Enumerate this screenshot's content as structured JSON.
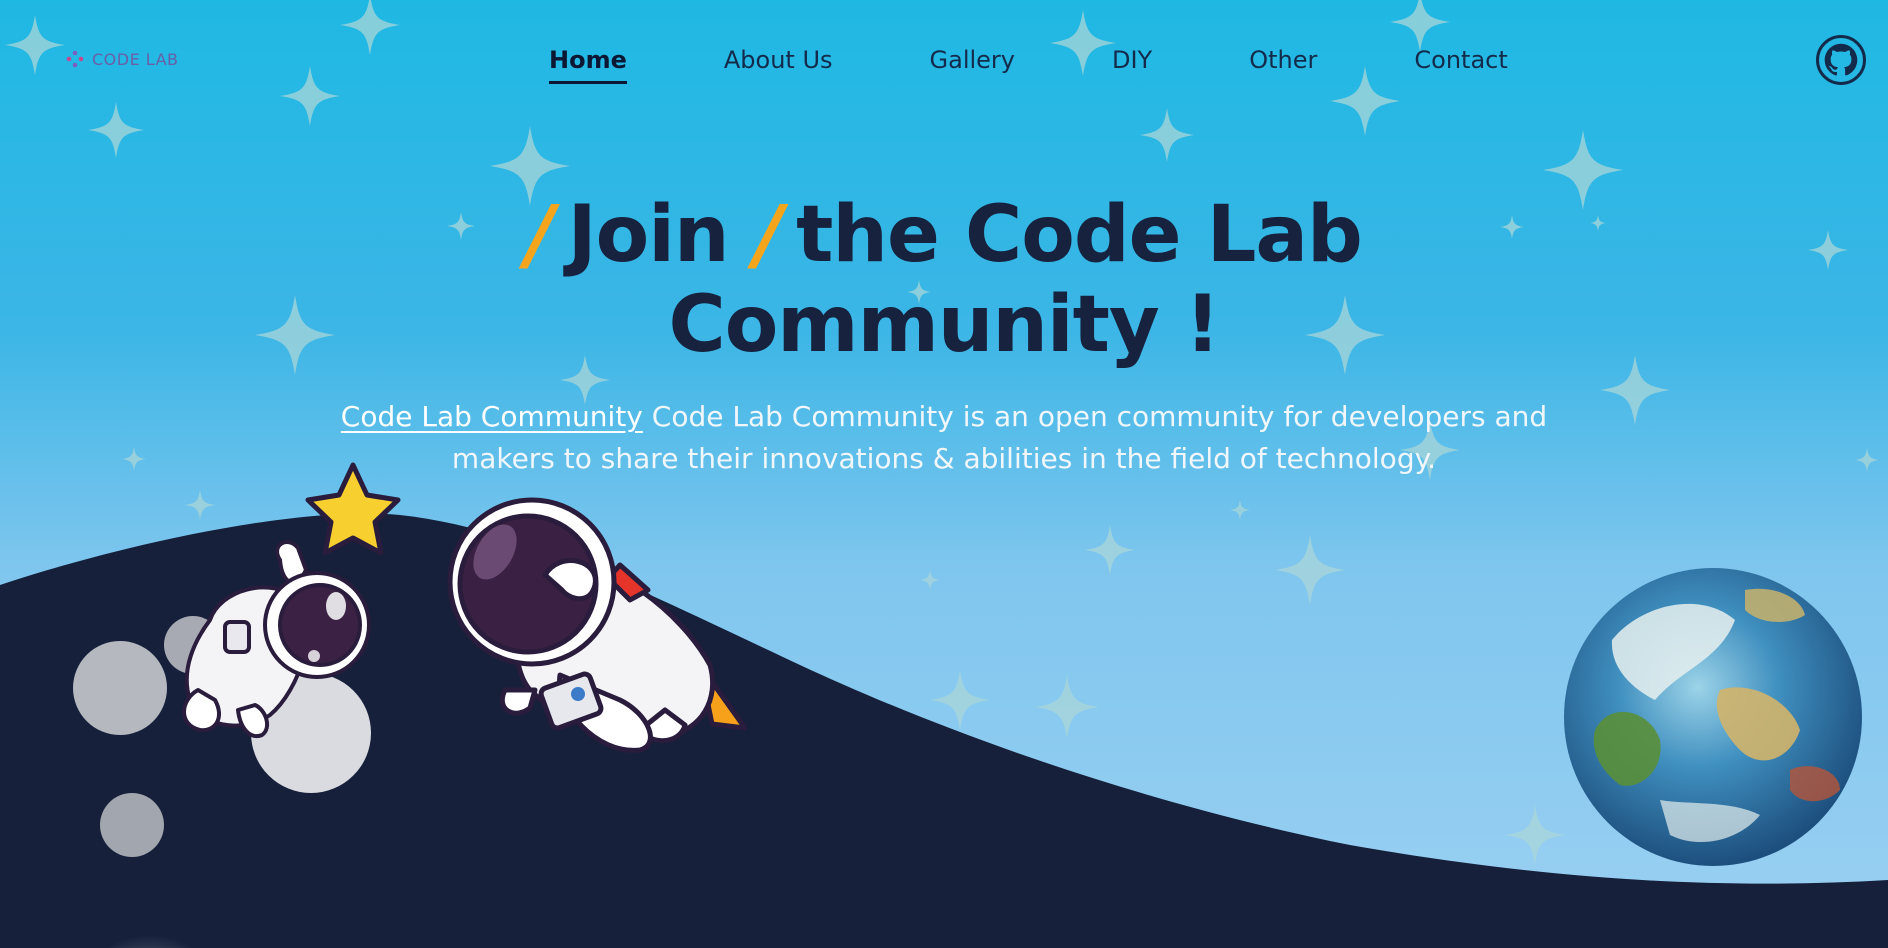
{
  "brand": {
    "name": "CODE LAB"
  },
  "nav": {
    "items": [
      {
        "label": "Home",
        "active": true
      },
      {
        "label": "About Us"
      },
      {
        "label": "Gallery"
      },
      {
        "label": "DIY"
      },
      {
        "label": "Other"
      },
      {
        "label": "Contact"
      }
    ]
  },
  "hero": {
    "slash": "/",
    "title_word1": "Join",
    "title_rest": "the Code Lab",
    "title_line2": "Community !",
    "desc_link": "Code Lab Community",
    "desc_text": " Code Lab Community is an open community for developers and makers to share their innovations & abilities in the field of technology."
  },
  "icons": {
    "github": "github-icon",
    "logo": "code-lab-logo-icon"
  },
  "colors": {
    "sky_top": "#1fb8e3",
    "sky_bottom": "#9bd0f2",
    "hill": "#16203b",
    "accent": "#f5a51c",
    "heading": "#16223e"
  }
}
